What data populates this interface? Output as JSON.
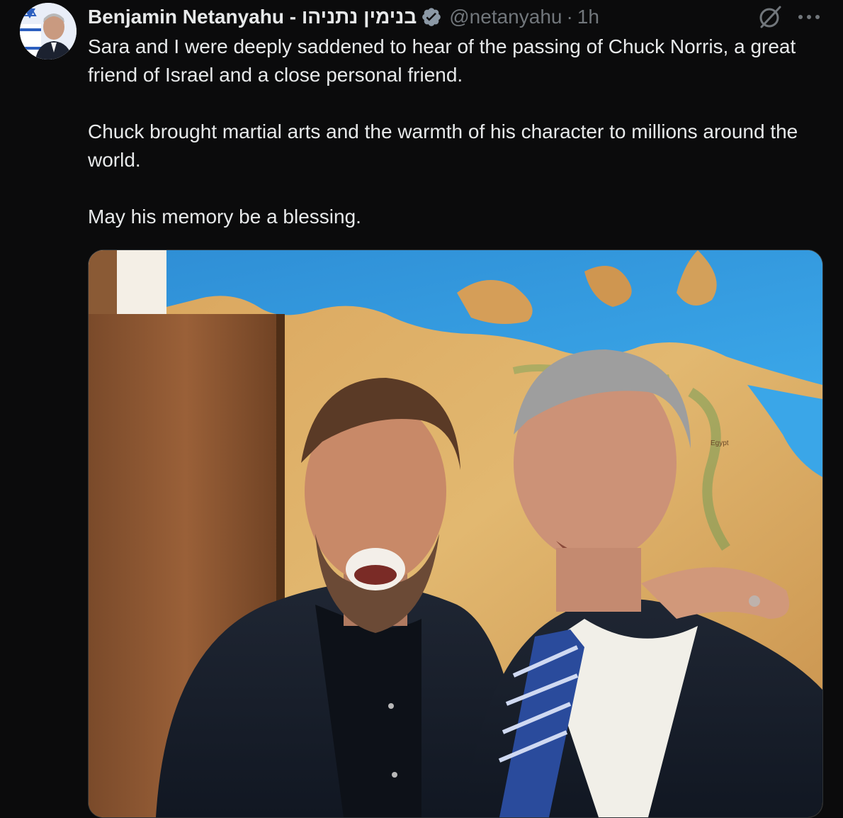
{
  "author": {
    "display_name": "Benjamin Netanyahu - בנימין נתניהו",
    "handle": "@netanyahu",
    "separator": "·",
    "timestamp": "1h",
    "verified": true
  },
  "tweet": {
    "paragraphs": [
      "Sara and I were deeply saddened to hear of the passing of Chuck Norris, a great friend of Israel and a close personal friend.",
      "Chuck brought martial arts and the warmth of his character to millions around the world.",
      "May his memory be a blessing."
    ]
  },
  "media": {
    "map_label_egypt": "Egypt"
  },
  "icons": {
    "grok": "grok-icon",
    "more": "more-icon",
    "verified": "verified-badge-icon"
  },
  "colors": {
    "background": "#0b0b0c",
    "text": "#e7e9ea",
    "muted": "#71767b"
  }
}
